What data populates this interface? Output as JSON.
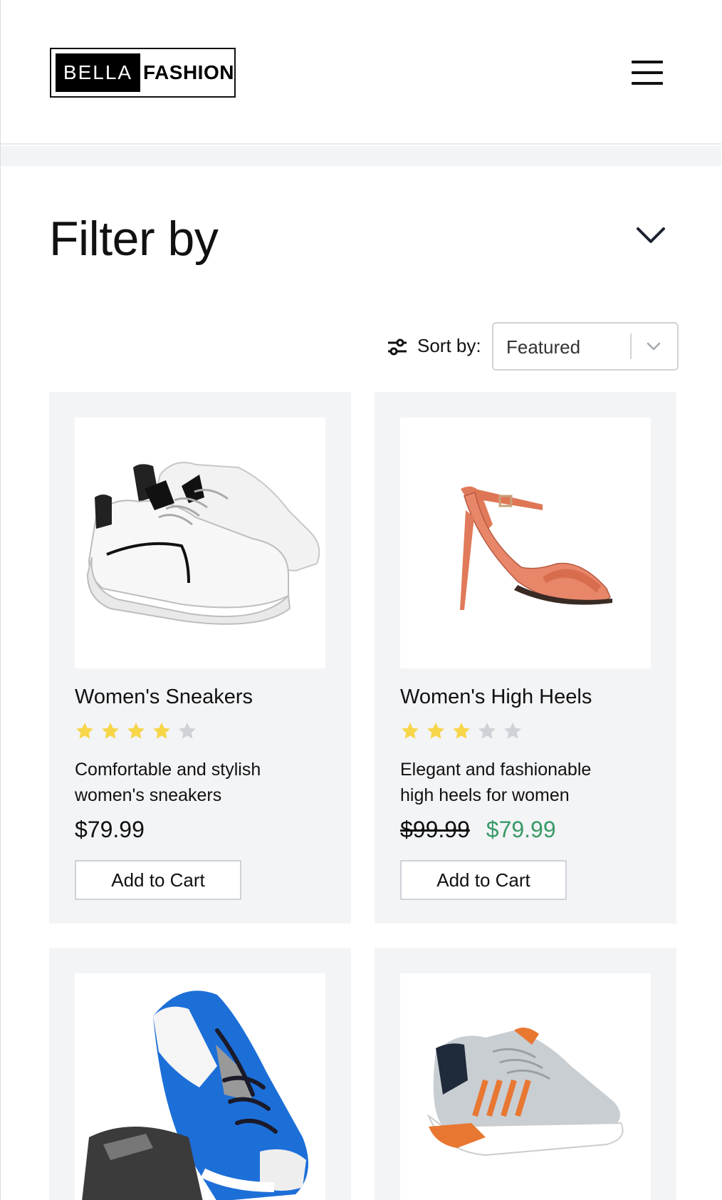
{
  "header": {
    "logo_left": "BELLA",
    "logo_right": "FASHION",
    "menu_icon": "hamburger-menu-icon"
  },
  "filter": {
    "title": "Filter by",
    "toggle_icon": "chevron-down-icon"
  },
  "sort": {
    "icon": "sliders-icon",
    "label": "Sort by:",
    "selected": "Featured",
    "caret_icon": "chevron-down-icon"
  },
  "products": [
    {
      "title": "Women's Sneakers",
      "rating": 4,
      "rating_max": 5,
      "description": "Comfortable and stylish women's sneakers",
      "price": "$79.99",
      "old_price": "",
      "cart_label": "Add to Cart"
    },
    {
      "title": "Women's High Heels",
      "rating": 3,
      "rating_max": 5,
      "description": "Elegant and fashionable high heels for women",
      "price": "$79.99",
      "old_price": "$99.99",
      "cart_label": "Add to Cart"
    },
    {
      "title": "",
      "rating": null,
      "description": "",
      "price": "",
      "old_price": "",
      "cart_label": ""
    },
    {
      "title": "",
      "rating": null,
      "description": "",
      "price": "",
      "old_price": "",
      "cart_label": ""
    }
  ],
  "colors": {
    "star_filled": "#f7d64a",
    "star_empty": "#cfd2d6",
    "sale_price": "#3a9a68",
    "card_bg": "#f3f4f6"
  }
}
